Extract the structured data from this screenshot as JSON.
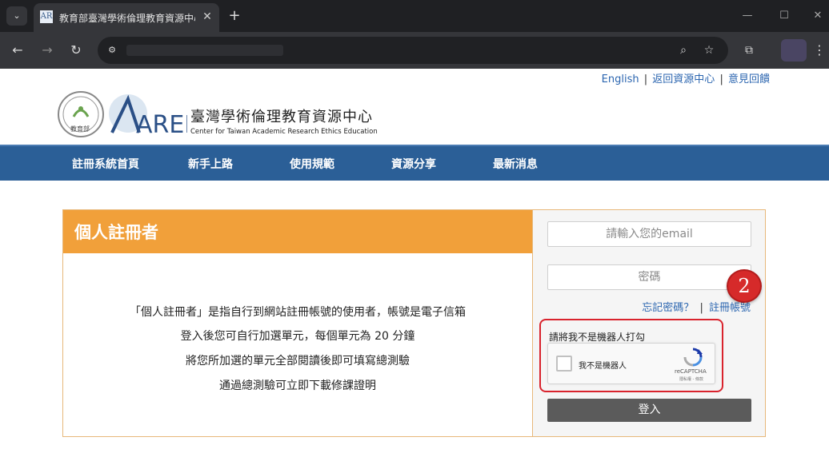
{
  "browser": {
    "tab_title": "教育部臺灣學術倫理教育資源中心",
    "favicon_text": "AR",
    "tab_close": "✕",
    "new_tab": "+",
    "tab_menu_icon": "chevron-down-icon",
    "window": {
      "minimize": "—",
      "maximize": "☐",
      "close": "✕"
    },
    "nav": {
      "back": "←",
      "forward": "→",
      "reload": "↻"
    },
    "omnibox_icons": {
      "site_info": "⚙",
      "zoom": "⌕",
      "bookmark": "☆",
      "extensions": "⧉",
      "menu": "⋮"
    }
  },
  "top_links": {
    "english": "English",
    "back_to_center": "返回資源中心",
    "feedback": "意見回饋",
    "separator": "|"
  },
  "header": {
    "moe_logo_text": "教育部",
    "aree_logo_text": "AREE",
    "title": "臺灣學術倫理教育資源中心",
    "subtitle": "Center for Taiwan Academic Research Ethics Education"
  },
  "navbar": {
    "items": [
      {
        "label": "註冊系統首頁"
      },
      {
        "label": "新手上路"
      },
      {
        "label": "使用規範"
      },
      {
        "label": "資源分享"
      },
      {
        "label": "最新消息"
      }
    ]
  },
  "panel": {
    "title": "個人註冊者",
    "description": [
      "「個人註冊者」是指自行到網站註冊帳號的使用者，帳號是電子信箱",
      "登入後您可自行加選單元，每個單元為 20 分鐘",
      "將您所加選的單元全部閱讀後即可填寫總測驗",
      "通過總測驗可立即下載修課證明"
    ]
  },
  "login": {
    "email_placeholder": "請輸入您的email",
    "password_placeholder": "密碼",
    "forgot_password": "忘記密碼？",
    "separator": "|",
    "register": "註冊帳號",
    "captcha_label": "請將我不是機器人打勾",
    "recaptcha_checkbox_label": "我不是機器人",
    "recaptcha_brand": "reCAPTCHA",
    "recaptcha_terms": "隱私權 - 條款",
    "login_button": "登入"
  },
  "annotation": {
    "marker": "2"
  },
  "colors": {
    "nav_blue": "#2b5f97",
    "header_orange": "#f1a03a",
    "link_blue": "#2c66b0",
    "highlight_red": "#d9232d",
    "button_gray": "#5b5b5b"
  }
}
